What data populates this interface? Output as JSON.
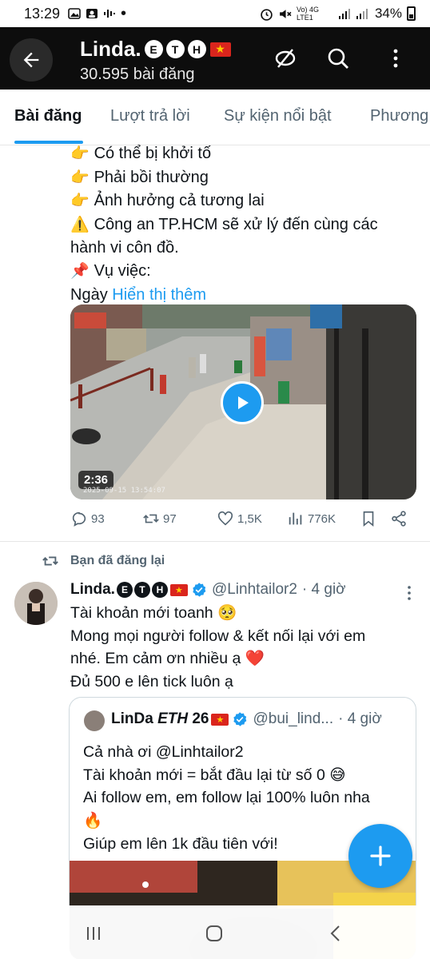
{
  "status_bar": {
    "time": "13:29",
    "network": "Vo) 4G LTE1",
    "battery": "34%"
  },
  "header": {
    "name": "Linda.",
    "badges": [
      "E",
      "T",
      "H"
    ],
    "flag": "★",
    "post_count": "30.595 bài đăng"
  },
  "tabs": [
    "Bài đăng",
    "Lượt trả lời",
    "Sự kiện nổi bật",
    "Phương"
  ],
  "tweet1": {
    "lines": [
      {
        "emoji": "👉",
        "text": "Có thể bị khởi tố"
      },
      {
        "emoji": "👉",
        "text": "Phải bồi thường"
      },
      {
        "emoji": "👉",
        "text": "Ảnh hưởng cả tương lai"
      },
      {
        "emoji": "⚠️",
        "text": "Công an TP.HCM sẽ xử lý đến cùng các"
      },
      {
        "emoji": "",
        "text": "hành vi côn đồ."
      },
      {
        "emoji": "📌",
        "text": "Vụ việc:"
      }
    ],
    "last_line_prefix": "Ngày ",
    "show_more": "Hiển thị thêm",
    "video_duration": "2:36",
    "video_timestamp": "2025-09-15 13:54:07",
    "stats": {
      "replies": "93",
      "reposts": "97",
      "likes": "1,5K",
      "views": "776K"
    }
  },
  "tweet2": {
    "repost_label": "Bạn đã đăng lại",
    "name": "Linda.",
    "badges": [
      "E",
      "T",
      "H"
    ],
    "handle": "@Linhtailor2",
    "time": "· 4 giờ",
    "lines": [
      "Tài khoản mới toanh 🥺",
      "Mong mọi người follow & kết nối lại với em",
      "nhé. Em cảm ơn nhiều ạ ❤️",
      "Đủ 500 e lên tick luôn ạ"
    ],
    "quote": {
      "name": "LinDa",
      "name_italic": "ETH",
      "name_suffix": "26",
      "handle": "@bui_lind...",
      "time": "· 4 giờ",
      "lines": [
        "Cả nhà ơi  @Linhtailor2",
        "Tài khoản mới = bắt đầu lại từ số 0 😅",
        "Ai follow em, em follow lại 100% luôn nha",
        "🔥",
        "Giúp em lên 1k đầu tiên với!"
      ]
    }
  },
  "colors": {
    "accent": "#1d9bf0",
    "header_bg": "#0d0d0d",
    "muted": "#536471",
    "verified": "#1d9bf0"
  },
  "icons": [
    "back-arrow-icon",
    "no-translate-icon",
    "search-icon",
    "more-vertical-icon",
    "reply-icon",
    "repost-icon",
    "like-icon",
    "views-icon",
    "bookmark-icon",
    "share-icon",
    "verified-icon",
    "compose-plus-icon",
    "recents-icon",
    "home-icon",
    "back-icon"
  ]
}
